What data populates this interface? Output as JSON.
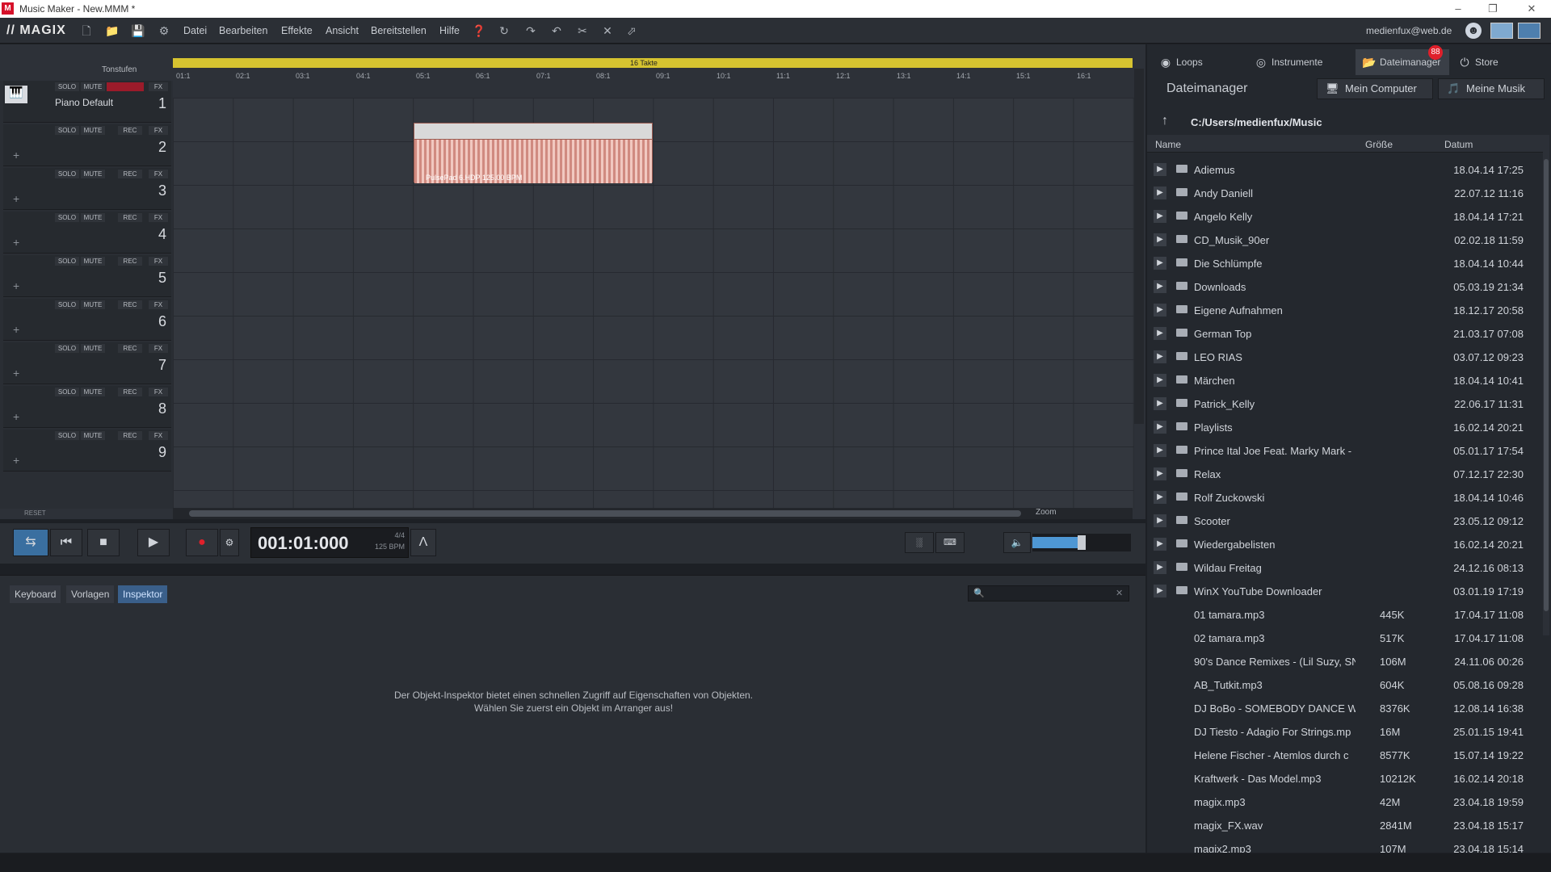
{
  "window": {
    "title": "Music Maker - New.MMM *",
    "logo_letter": "M"
  },
  "menubar": {
    "logo": "// MAGIX",
    "items": [
      "Datei",
      "Bearbeiten",
      "Effekte",
      "Ansicht",
      "Bereitstellen",
      "Hilfe"
    ],
    "user": "medienfux@web.de"
  },
  "arranger": {
    "ruler_label": "16 Takte",
    "bars": [
      "01:1",
      "02:1",
      "03:1",
      "04:1",
      "05:1",
      "06:1",
      "07:1",
      "08:1",
      "09:1",
      "10:1",
      "11:1",
      "12:1",
      "13:1",
      "14:1",
      "15:1",
      "16:1"
    ],
    "tonstufen": "Tonstufen",
    "tracks": [
      {
        "num": "1",
        "name": "Piano Default"
      },
      {
        "num": "2",
        "name": ""
      },
      {
        "num": "3",
        "name": ""
      },
      {
        "num": "4",
        "name": ""
      },
      {
        "num": "5",
        "name": ""
      },
      {
        "num": "6",
        "name": ""
      },
      {
        "num": "7",
        "name": ""
      },
      {
        "num": "8",
        "name": ""
      },
      {
        "num": "9",
        "name": ""
      }
    ],
    "btn_solo": "SOLO",
    "btn_mute": "MUTE",
    "btn_rec": "REC",
    "btn_fx": "FX",
    "clip_label": "PulsePad 6.HDP  125.00 BPM",
    "reset": "RESET",
    "zoom": "Zoom"
  },
  "transport": {
    "time": "001:01:000",
    "signature": "4/4",
    "bpm": "125 BPM"
  },
  "lower": {
    "tabs": [
      "Keyboard",
      "Vorlagen",
      "Inspektor"
    ],
    "active_tab": "Inspektor",
    "inspector_line1": "Der Objekt-Inspektor bietet einen schnellen Zugriff auf Eigenschaften von Objekten.",
    "inspector_line2": "Wählen Sie zuerst ein Objekt im Arranger aus!"
  },
  "right_panel": {
    "tabs": [
      "Loops",
      "Instrumente",
      "Dateimanager",
      "Store"
    ],
    "active_tab": "Dateimanager",
    "store_badge": "88",
    "title": "Dateimanager",
    "btn_computer": "Mein Computer",
    "btn_music": "Meine Musik",
    "path": "C:/Users/medienfux/Music",
    "columns": {
      "name": "Name",
      "size": "Größe",
      "date": "Datum"
    },
    "folders": [
      {
        "name": "Adiemus",
        "date": "18.04.14 17:25"
      },
      {
        "name": "Andy Daniell",
        "date": "22.07.12 11:16"
      },
      {
        "name": "Angelo Kelly",
        "date": "18.04.14 17:21"
      },
      {
        "name": "CD_Musik_90er",
        "date": "02.02.18 11:59"
      },
      {
        "name": "Die Schlümpfe",
        "date": "18.04.14 10:44"
      },
      {
        "name": "Downloads",
        "date": "05.03.19 21:34"
      },
      {
        "name": "Eigene Aufnahmen",
        "date": "18.12.17 20:58"
      },
      {
        "name": "German Top",
        "date": "21.03.17 07:08"
      },
      {
        "name": "LEO RIAS",
        "date": "03.07.12 09:23"
      },
      {
        "name": "Märchen",
        "date": "18.04.14 10:41"
      },
      {
        "name": "Patrick_Kelly",
        "date": "22.06.17 11:31"
      },
      {
        "name": "Playlists",
        "date": "16.02.14 20:21"
      },
      {
        "name": "Prince Ital Joe Feat. Marky Mark -",
        "date": "05.01.17 17:54"
      },
      {
        "name": "Relax",
        "date": "07.12.17 22:30"
      },
      {
        "name": "Rolf Zuckowski",
        "date": "18.04.14 10:46"
      },
      {
        "name": "Scooter",
        "date": "23.05.12 09:12"
      },
      {
        "name": "Wiedergabelisten",
        "date": "16.02.14 20:21"
      },
      {
        "name": "Wildau Freitag",
        "date": "24.12.16 08:13"
      },
      {
        "name": "WinX YouTube Downloader",
        "date": "03.01.19 17:19"
      }
    ],
    "files": [
      {
        "name": "01 tamara.mp3",
        "size": "445K",
        "date": "17.04.17 11:08"
      },
      {
        "name": "02 tamara.mp3",
        "size": "517K",
        "date": "17.04.17 11:08"
      },
      {
        "name": "90's Dance Remixes - (Lil Suzy, SN",
        "size": "106M",
        "date": "24.11.06 00:26"
      },
      {
        "name": "AB_Tutkit.mp3",
        "size": "604K",
        "date": "05.08.16 09:28"
      },
      {
        "name": "DJ BoBo - SOMEBODY DANCE WI",
        "size": "8376K",
        "date": "12.08.14 16:38"
      },
      {
        "name": "DJ Tiesto - Adagio For Strings.mp",
        "size": "16M",
        "date": "25.01.15 19:41"
      },
      {
        "name": "Helene Fischer - Atemlos durch c",
        "size": "8577K",
        "date": "15.07.14 19:22"
      },
      {
        "name": "Kraftwerk - Das Model.mp3",
        "size": "10212K",
        "date": "16.02.14 20:18"
      },
      {
        "name": "magix.mp3",
        "size": "42M",
        "date": "23.04.18 19:59"
      },
      {
        "name": "magix_FX.wav",
        "size": "2841M",
        "date": "23.04.18 15:17"
      },
      {
        "name": "magix2.mp3",
        "size": "107M",
        "date": "23.04.18 15:14"
      }
    ]
  }
}
